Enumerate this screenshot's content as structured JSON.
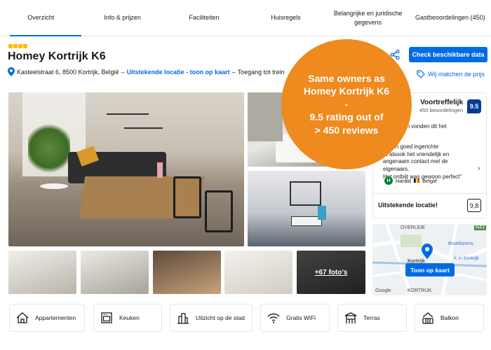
{
  "tabs": [
    {
      "label": "Overzicht",
      "active": true
    },
    {
      "label": "Info & prijzen"
    },
    {
      "label": "Faciliteiten"
    },
    {
      "label": "Huisregels"
    },
    {
      "label": "Belangrijke en juridische gegevens"
    },
    {
      "label": "Gastbeoordelingen (450)"
    }
  ],
  "header": {
    "star_count": 4,
    "title": "Homey Kortrijk K6",
    "address": "Kasteelstraat 6, 8500 Kortrijk, België",
    "separator": "–",
    "location_link": "Uitstekende locatie - toon op kaart",
    "transport_note": "Toegang tot trein"
  },
  "actions": {
    "share_icon": "share-icon",
    "check_availability": "Check beschikbare data",
    "price_match": "Wij matchen de prijs"
  },
  "gallery": {
    "more_photos": "+67 foto's"
  },
  "review": {
    "label": "Voortreffelijk",
    "count": "450 beoordelingen",
    "score": "9.5",
    "intro": "er verbleven vonden dit het",
    "quote": "me en goed ingerichte\nrs alsook het vriendelijk en\nangenaam contact met de\neigenaars.\nHet ontbijt was gewoon perfect\"",
    "reviewer_initial": "H",
    "reviewer_name": "Harald",
    "reviewer_country": "België",
    "location_label": "Uitstekende locatie!",
    "location_score": "9,8"
  },
  "map": {
    "button": "Toon op kaart",
    "labels": [
      "OVERLEIE",
      "Broeltorens",
      "K in Kortrijk",
      "Kortrijk",
      "Google",
      "KORTRIJK",
      "N43"
    ]
  },
  "promo": {
    "lines": [
      "Same owners as",
      "Homey Kortrijk K6",
      "-",
      "9.5 rating out of",
      "> 450 reviews"
    ],
    "color": "#EE8A1E"
  },
  "facilities": [
    {
      "label": "Appartementen",
      "icon": "house-icon"
    },
    {
      "label": "Keuken",
      "icon": "oven-icon"
    },
    {
      "label": "Uitzicht op de stad",
      "icon": "city-icon"
    },
    {
      "label": "Gratis WiFi",
      "icon": "wifi-icon"
    },
    {
      "label": "Terras",
      "icon": "terrace-icon"
    },
    {
      "label": "Balkon",
      "icon": "balcony-icon"
    }
  ],
  "colors": {
    "brand": "#006CE4",
    "score": "#003B95",
    "star": "#FEBB02"
  }
}
